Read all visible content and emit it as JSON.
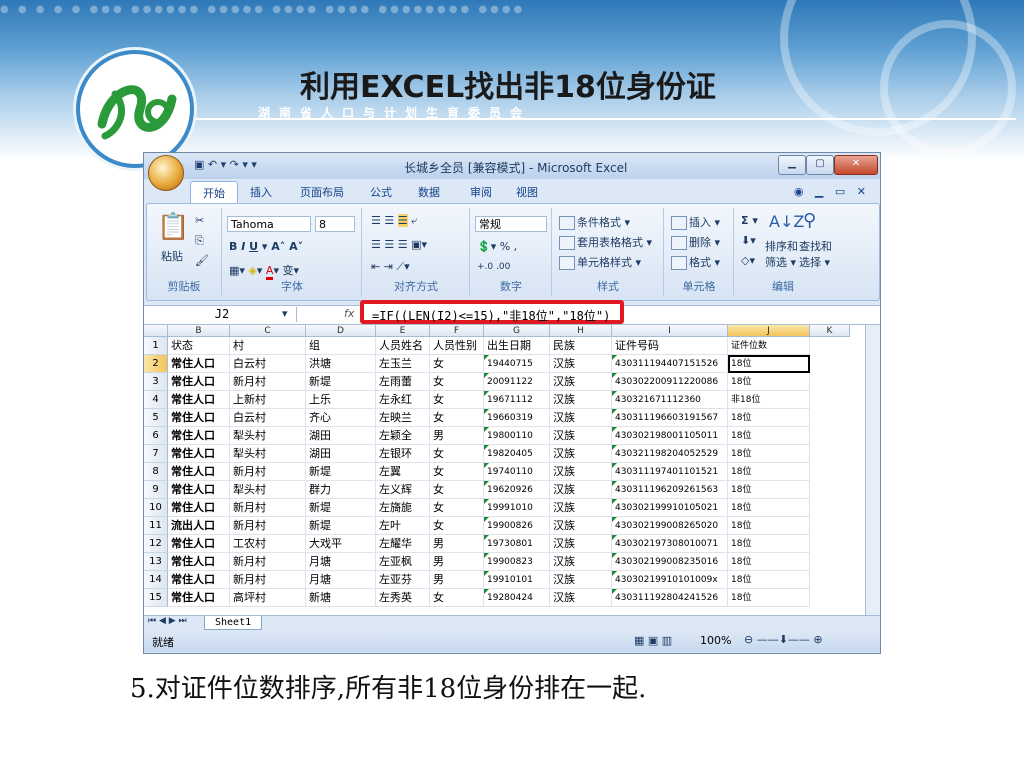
{
  "slide": {
    "title": "利用EXCEL找出非18位身份证",
    "subtitle": "湖南省人口与计划生育委员会",
    "caption": "5.对证件位数排序,所有非18位身份排在一起."
  },
  "excel": {
    "window_title": "长城乡全员 [兼容模式] - Microsoft Excel",
    "tabs": [
      "开始",
      "插入",
      "页面布局",
      "公式",
      "数据",
      "审阅",
      "视图"
    ],
    "ribbon": {
      "clipboard": {
        "label": "剪贴板",
        "paste": "粘贴"
      },
      "font": {
        "label": "字体",
        "name": "Tahoma",
        "size": "8"
      },
      "alignment": {
        "label": "对齐方式"
      },
      "number": {
        "label": "数字",
        "format": "常规"
      },
      "styles": {
        "label": "样式",
        "cond": "条件格式",
        "table": "套用表格格式",
        "cell": "单元格样式"
      },
      "cells": {
        "label": "单元格",
        "insert": "插入",
        "delete": "删除",
        "format": "格式"
      },
      "editing": {
        "label": "编辑",
        "sort": "排序和",
        "filter": "筛选",
        "find": "查找和",
        "select": "选择"
      }
    },
    "name_box": "J2",
    "fx": "fx",
    "formula": "=IF((LEN(I2)<=15),\"非18位\",\"18位\")",
    "columns": [
      "B",
      "C",
      "D",
      "E",
      "F",
      "G",
      "H",
      "I",
      "J",
      "K"
    ],
    "rows": [
      {
        "n": "1",
        "c": [
          "状态",
          "村",
          "组",
          "人员姓名",
          "人员性别",
          "出生日期",
          "民族",
          "证件号码",
          "证件位数"
        ]
      },
      {
        "n": "2",
        "c": [
          "常住人口",
          "白云村",
          "洪塘",
          "左玉兰",
          "女",
          "19440715",
          "汉族",
          "430311194407151526",
          "18位"
        ]
      },
      {
        "n": "3",
        "c": [
          "常住人口",
          "新月村",
          "新堤",
          "左雨蕾",
          "女",
          "20091122",
          "汉族",
          "430302200911220086",
          "18位"
        ]
      },
      {
        "n": "4",
        "c": [
          "常住人口",
          "上新村",
          "上乐",
          "左永红",
          "女",
          "19671112",
          "汉族",
          "430321671112360",
          "非18位"
        ]
      },
      {
        "n": "5",
        "c": [
          "常住人口",
          "白云村",
          "齐心",
          "左映兰",
          "女",
          "19660319",
          "汉族",
          "430311196603191567",
          "18位"
        ]
      },
      {
        "n": "6",
        "c": [
          "常住人口",
          "犁头村",
          "湖田",
          "左颖全",
          "男",
          "19800110",
          "汉族",
          "430302198001105011",
          "18位"
        ]
      },
      {
        "n": "7",
        "c": [
          "常住人口",
          "犁头村",
          "湖田",
          "左银环",
          "女",
          "19820405",
          "汉族",
          "430321198204052529",
          "18位"
        ]
      },
      {
        "n": "8",
        "c": [
          "常住人口",
          "新月村",
          "新堤",
          "左翼",
          "女",
          "19740110",
          "汉族",
          "430311197401101521",
          "18位"
        ]
      },
      {
        "n": "9",
        "c": [
          "常住人口",
          "犁头村",
          "群力",
          "左义辉",
          "女",
          "19620926",
          "汉族",
          "430311196209261563",
          "18位"
        ]
      },
      {
        "n": "10",
        "c": [
          "常住人口",
          "新月村",
          "新堤",
          "左旖旎",
          "女",
          "19991010",
          "汉族",
          "430302199910105021",
          "18位"
        ]
      },
      {
        "n": "11",
        "c": [
          "流出人口",
          "新月村",
          "新堤",
          "左叶",
          "女",
          "19900826",
          "汉族",
          "430302199008265020",
          "18位"
        ]
      },
      {
        "n": "12",
        "c": [
          "常住人口",
          "工农村",
          "大戏平",
          "左耀华",
          "男",
          "19730801",
          "汉族",
          "430302197308010071",
          "18位"
        ]
      },
      {
        "n": "13",
        "c": [
          "常住人口",
          "新月村",
          "月塘",
          "左亚枫",
          "男",
          "19900823",
          "汉族",
          "430302199008235016",
          "18位"
        ]
      },
      {
        "n": "14",
        "c": [
          "常住人口",
          "新月村",
          "月塘",
          "左亚芬",
          "男",
          "19910101",
          "汉族",
          "43030219910101009x",
          "18位"
        ]
      },
      {
        "n": "15",
        "c": [
          "常住人口",
          "高坪村",
          "新塘",
          "左秀英",
          "女",
          "19280424",
          "汉族",
          "430311192804241526",
          "18位"
        ]
      }
    ],
    "sheet_tab": "Sheet1",
    "status": "就绪",
    "zoom": "100%"
  }
}
